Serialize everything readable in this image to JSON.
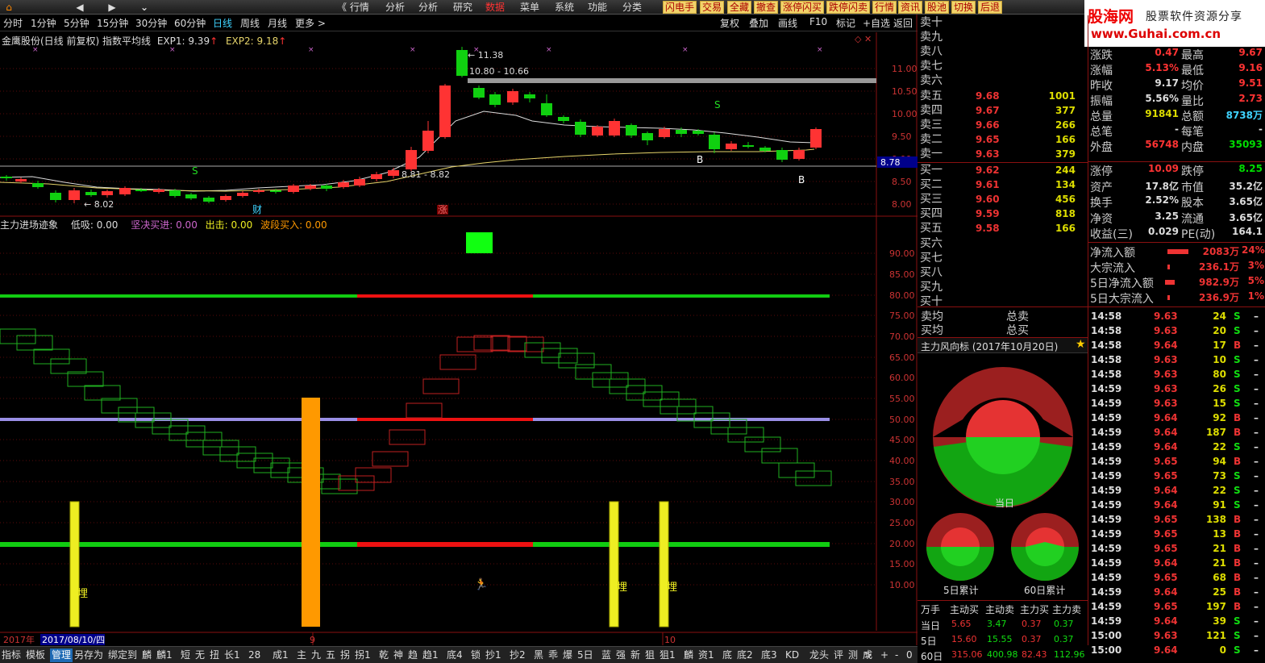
{
  "topbar": {
    "nav": [
      "⌂",
      "◀",
      "▶",
      "⌄"
    ],
    "menus": [
      "《 行情",
      "分析",
      "分析",
      "研究",
      "数据",
      "菜单",
      "系统",
      "功能",
      "分类"
    ],
    "quick_buttons": [
      "闪电手",
      "交易",
      "全藏",
      "撤查",
      "涨停闪买",
      "跌停闪卖",
      "行情",
      "资讯",
      "股池",
      "切换",
      "后退"
    ],
    "brand_title": "股海网",
    "brand_subtitle": "股票软件资源分享",
    "brand_url": "www.Guhai.com.cn"
  },
  "periodbar": {
    "periods": [
      "分时",
      "1分钟",
      "5分钟",
      "15分钟",
      "30分钟",
      "60分钟",
      "日线",
      "周线",
      "月线",
      "更多 >"
    ],
    "active_period": "日线",
    "tools": [
      "复权",
      "叠加",
      "画线",
      "F10",
      "标记",
      "+自选",
      "返回"
    ]
  },
  "main_chart": {
    "title": "金鹰股份(日线 前复权) 指数平均线",
    "exp1_label": "EXP1: 9.39",
    "exp2_label": "EXP2: 9.18",
    "price_axis": [
      "11.00",
      "10.50",
      "10.00",
      "9.50",
      "9.00",
      "8.50",
      "8.00"
    ],
    "current_price_tag": "8.78",
    "annotations": {
      "high": "← 11.38",
      "range1": "10.80 - 10.66",
      "range2": "8.81 - 8.82",
      "low": "← 8.02",
      "cai": "财",
      "zhang": "涨",
      "s1": "S",
      "s2": "S",
      "b1": "B",
      "b2": "B"
    }
  },
  "sub_chart": {
    "title": "主力进场迹象",
    "low_absorb": "低吸: 0.00",
    "firm_buy": "坚决买进: 0.00",
    "exit": "出击: 0.00",
    "wave_buy": "波段买入: 0.00",
    "value_axis": [
      "90.00",
      "85.00",
      "80.00",
      "75.00",
      "70.00",
      "65.00",
      "60.00",
      "55.00",
      "50.00",
      "45.00",
      "40.00",
      "35.00",
      "30.00",
      "25.00",
      "20.00",
      "15.00",
      "10.00"
    ],
    "bar_labels": [
      "埋",
      "埋",
      "埋"
    ]
  },
  "date_axis": {
    "year_label": "2017年",
    "date_label": "2017/08/10/四",
    "month_ticks": [
      "9",
      "10"
    ]
  },
  "orderbook": {
    "sells": [
      {
        "label": "卖十",
        "price": "",
        "vol": ""
      },
      {
        "label": "卖九",
        "price": "",
        "vol": ""
      },
      {
        "label": "卖八",
        "price": "",
        "vol": ""
      },
      {
        "label": "卖七",
        "price": "",
        "vol": ""
      },
      {
        "label": "卖六",
        "price": "",
        "vol": ""
      },
      {
        "label": "卖五",
        "price": "9.68",
        "vol": "1001"
      },
      {
        "label": "卖四",
        "price": "9.67",
        "vol": "377"
      },
      {
        "label": "卖三",
        "price": "9.66",
        "vol": "266"
      },
      {
        "label": "卖二",
        "price": "9.65",
        "vol": "166"
      },
      {
        "label": "卖一",
        "price": "9.63",
        "vol": "379"
      }
    ],
    "buys": [
      {
        "label": "买一",
        "price": "9.62",
        "vol": "244"
      },
      {
        "label": "买二",
        "price": "9.61",
        "vol": "134"
      },
      {
        "label": "买三",
        "price": "9.60",
        "vol": "456"
      },
      {
        "label": "买四",
        "price": "9.59",
        "vol": "818"
      },
      {
        "label": "买五",
        "price": "9.58",
        "vol": "166"
      },
      {
        "label": "买六",
        "price": "",
        "vol": ""
      },
      {
        "label": "买七",
        "price": "",
        "vol": ""
      },
      {
        "label": "买八",
        "price": "",
        "vol": ""
      },
      {
        "label": "买九",
        "price": "",
        "vol": ""
      },
      {
        "label": "买十",
        "price": "",
        "vol": ""
      }
    ],
    "avg_sell": "卖均",
    "avg_buy": "买均",
    "total_sell": "总卖",
    "total_buy": "总买"
  },
  "stats": [
    {
      "l1": "涨跌",
      "v1": "0.47",
      "c1": "#ff3333",
      "l2": "最高",
      "v2": "9.67",
      "c2": "#ff3333"
    },
    {
      "l1": "涨幅",
      "v1": "5.13%",
      "c1": "#ff3333",
      "l2": "最低",
      "v2": "9.16",
      "c2": "#ff3333"
    },
    {
      "l1": "昨收",
      "v1": "9.17",
      "c1": "#dddddd",
      "l2": "均价",
      "v2": "9.51",
      "c2": "#ff3333"
    },
    {
      "l1": "振幅",
      "v1": "5.56%",
      "c1": "#dddddd",
      "l2": "量比",
      "v2": "2.73",
      "c2": "#ff3333"
    },
    {
      "l1": "总量",
      "v1": "91841",
      "c1": "#dddd00",
      "l2": "总额",
      "v2": "8738万",
      "c2": "#3fd3ff"
    },
    {
      "l1": "总笔",
      "v1": "-",
      "c1": "#dddddd",
      "l2": "每笔",
      "v2": "-",
      "c2": "#dddddd"
    },
    {
      "l1": "外盘",
      "v1": "56748",
      "c1": "#ff3333",
      "l2": "内盘",
      "v2": "35093",
      "c2": "#00dd00"
    }
  ],
  "stats2": [
    {
      "l1": "涨停",
      "v1": "10.09",
      "c1": "#ff3333",
      "l2": "跌停",
      "v2": "8.25",
      "c2": "#00dd00"
    },
    {
      "l1": "资产",
      "v1": "17.8亿",
      "c1": "#dddddd",
      "l2": "市值",
      "v2": "35.2亿",
      "c2": "#dddddd"
    },
    {
      "l1": "换手",
      "v1": "2.52%",
      "c1": "#dddddd",
      "l2": "股本",
      "v2": "3.65亿",
      "c2": "#dddddd"
    },
    {
      "l1": "净资",
      "v1": "3.25",
      "c1": "#dddddd",
      "l2": "流通",
      "v2": "3.65亿",
      "c2": "#dddddd"
    },
    {
      "l1": "收益(三)",
      "v1": "0.029",
      "c1": "#dddddd",
      "l2": "PE(动)",
      "v2": "164.1",
      "c2": "#dddddd"
    }
  ],
  "fund_flow": [
    {
      "label": "净流入额",
      "value": "2083万",
      "pct": "24%"
    },
    {
      "label": "大宗流入",
      "value": "236.1万",
      "pct": "3%"
    },
    {
      "label": "5日净流入额",
      "value": "982.9万",
      "pct": "5%"
    },
    {
      "label": "5日大宗流入",
      "value": "236.9万",
      "pct": "1%"
    }
  ],
  "windvane": {
    "title": "主力风向标 (2017年10月20日)",
    "today": "当日",
    "five_day": "5日累计",
    "sixty_day": "60日累计",
    "table_headers": [
      "万手",
      "主动买",
      "主动卖",
      "主力买",
      "主力卖"
    ],
    "table_rows": [
      [
        "当日",
        "5.65",
        "3.47",
        "0.37",
        "0.37"
      ],
      [
        "5日",
        "15.60",
        "15.55",
        "0.37",
        "0.37"
      ],
      [
        "60日",
        "315.06",
        "400.98",
        "82.43",
        "112.96"
      ]
    ]
  },
  "ticks": [
    {
      "time": "14:58",
      "price": "9.63",
      "vol": "24",
      "bs": "S"
    },
    {
      "time": "14:58",
      "price": "9.63",
      "vol": "20",
      "bs": "S"
    },
    {
      "time": "14:58",
      "price": "9.64",
      "vol": "17",
      "bs": "B"
    },
    {
      "time": "14:58",
      "price": "9.63",
      "vol": "10",
      "bs": "S"
    },
    {
      "time": "14:58",
      "price": "9.63",
      "vol": "80",
      "bs": "S"
    },
    {
      "time": "14:59",
      "price": "9.63",
      "vol": "26",
      "bs": "S"
    },
    {
      "time": "14:59",
      "price": "9.63",
      "vol": "15",
      "bs": "S"
    },
    {
      "time": "14:59",
      "price": "9.64",
      "vol": "92",
      "bs": "B"
    },
    {
      "time": "14:59",
      "price": "9.64",
      "vol": "187",
      "bs": "B"
    },
    {
      "time": "14:59",
      "price": "9.64",
      "vol": "22",
      "bs": "S"
    },
    {
      "time": "14:59",
      "price": "9.65",
      "vol": "94",
      "bs": "B"
    },
    {
      "time": "14:59",
      "price": "9.65",
      "vol": "73",
      "bs": "S"
    },
    {
      "time": "14:59",
      "price": "9.64",
      "vol": "22",
      "bs": "S"
    },
    {
      "time": "14:59",
      "price": "9.64",
      "vol": "91",
      "bs": "S"
    },
    {
      "time": "14:59",
      "price": "9.65",
      "vol": "138",
      "bs": "B"
    },
    {
      "time": "14:59",
      "price": "9.65",
      "vol": "13",
      "bs": "B"
    },
    {
      "time": "14:59",
      "price": "9.65",
      "vol": "21",
      "bs": "B"
    },
    {
      "time": "14:59",
      "price": "9.64",
      "vol": "21",
      "bs": "B"
    },
    {
      "time": "14:59",
      "price": "9.65",
      "vol": "68",
      "bs": "B"
    },
    {
      "time": "14:59",
      "price": "9.64",
      "vol": "25",
      "bs": "B"
    },
    {
      "time": "14:59",
      "price": "9.65",
      "vol": "197",
      "bs": "B"
    },
    {
      "time": "14:59",
      "price": "9.64",
      "vol": "39",
      "bs": "S"
    },
    {
      "time": "15:00",
      "price": "9.63",
      "vol": "121",
      "bs": "S"
    },
    {
      "time": "15:00",
      "price": "9.64",
      "vol": "0",
      "bs": "S"
    }
  ],
  "bottom_tabs": [
    "指标",
    "模板",
    "管理",
    "另存为",
    "绑定到",
    "麟",
    "麟1",
    "短",
    "无",
    "扭",
    "长1",
    "28",
    "成1",
    "主",
    "九",
    "五",
    "拐",
    "拐1",
    "乾",
    "神",
    "趋",
    "趋1",
    "底4",
    "锁",
    "抄1",
    "抄2",
    "黑",
    "乖",
    "爆",
    "5日",
    "蓝",
    "强",
    "新",
    "狙",
    "狙1",
    "麟",
    "资1",
    "底",
    "底2",
    "底3",
    "KD",
    "龙头",
    "评",
    "测",
    "成"
  ],
  "bottom_nav": [
    ">",
    "+",
    "-",
    "0"
  ]
}
